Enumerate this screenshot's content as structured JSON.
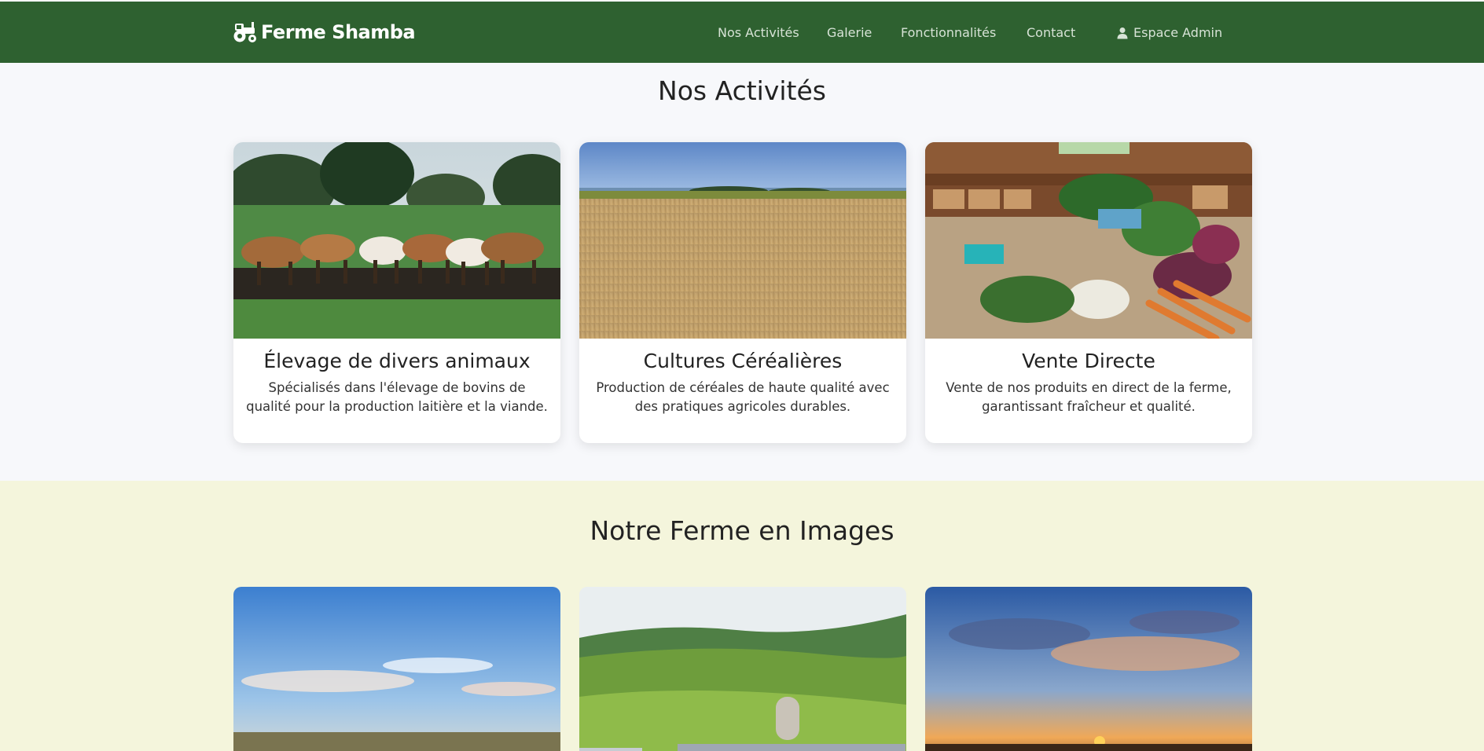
{
  "nav": {
    "brand": "Ferme Shamba",
    "brand_icon": "tractor-icon",
    "links": [
      "Nos Activités",
      "Galerie",
      "Fonctionnalités",
      "Contact"
    ],
    "admin_label": "Espace Admin",
    "admin_icon": "user-icon",
    "bg_color": "#2e6130"
  },
  "activities": {
    "title": "Nos Activités",
    "cards": [
      {
        "title": "Élevage de divers animaux",
        "text": "Spécialisés dans l'élevage de bovins de qualité pour la production laitière et la viande.",
        "image": "cows-in-pasture-photo"
      },
      {
        "title": "Cultures Céréalières",
        "text": "Production de céréales de haute qualité avec des pratiques agricoles durables.",
        "image": "wheat-field-photo"
      },
      {
        "title": "Vente Directe",
        "text": "Vente de nos produits en direct de la ferme, garantissant fraîcheur et qualité.",
        "image": "farm-market-vegetables-photo"
      }
    ]
  },
  "gallery": {
    "title": "Notre Ferme en Images",
    "images": [
      "sky-over-fields-photo",
      "farm-aerial-hills-photo",
      "sunset-farm-photo"
    ],
    "bg_color": "#f4f5dc"
  }
}
